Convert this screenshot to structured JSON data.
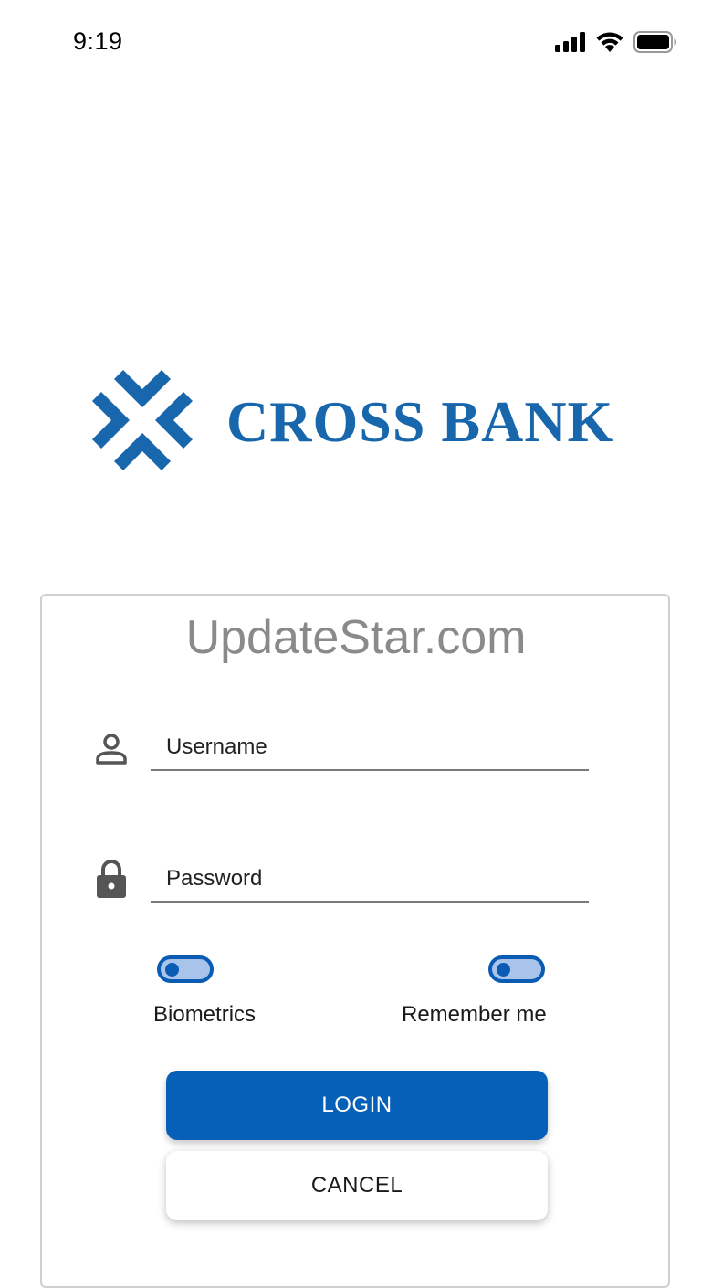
{
  "status_bar": {
    "time": "9:19",
    "icons": [
      "cellular-signal-icon",
      "wifi-icon",
      "battery-icon"
    ]
  },
  "logo": {
    "text": "CROSS BANK",
    "color": "#1867ad",
    "icon": "cross-bank-logo-icon"
  },
  "watermark": {
    "text": "UpdateStar.com"
  },
  "login_form": {
    "username": {
      "placeholder": "Username",
      "value": "",
      "icon": "person-icon"
    },
    "password": {
      "placeholder": "Password",
      "value": "",
      "icon": "lock-icon"
    },
    "toggles": {
      "biometrics": {
        "label": "Biometrics",
        "checked": false
      },
      "remember_me": {
        "label": "Remember me",
        "checked": false
      }
    },
    "login_label": "LOGIN",
    "cancel_label": "CANCEL"
  },
  "colors": {
    "accent": "#0760b8",
    "toggle_track": "#a9c4ea",
    "brand": "#1867ad"
  }
}
